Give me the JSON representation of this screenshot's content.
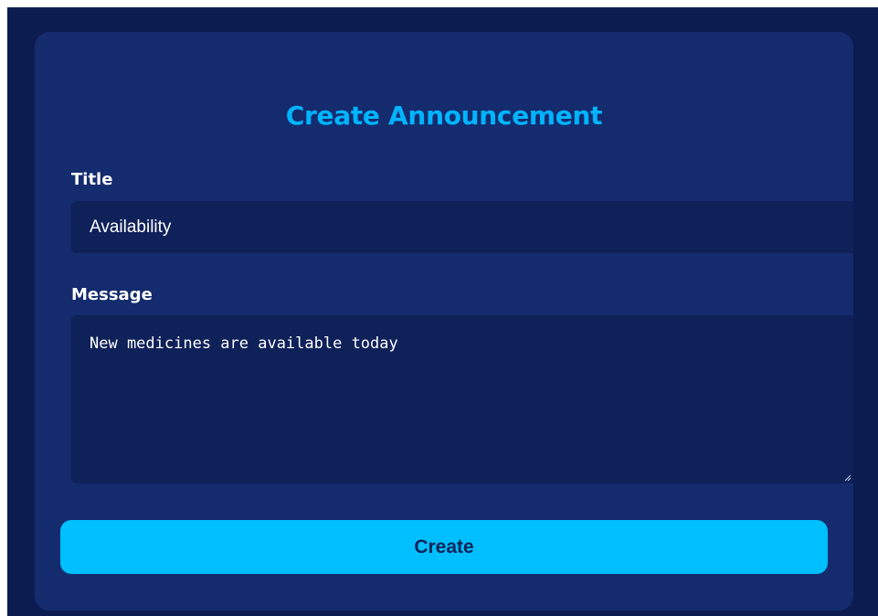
{
  "form": {
    "heading": "Create Announcement",
    "title_label": "Title",
    "title_value": "Availability",
    "message_label": "Message",
    "message_value": "New medicines are available today",
    "submit_label": "Create"
  },
  "colors": {
    "page_background": "#0c1c50",
    "card_background": "#142b6e",
    "field_background": "#0f2159",
    "accent": "#00b4ff",
    "button_background": "#00bfff",
    "button_text": "#0f2357",
    "label_text": "#ffffff"
  }
}
